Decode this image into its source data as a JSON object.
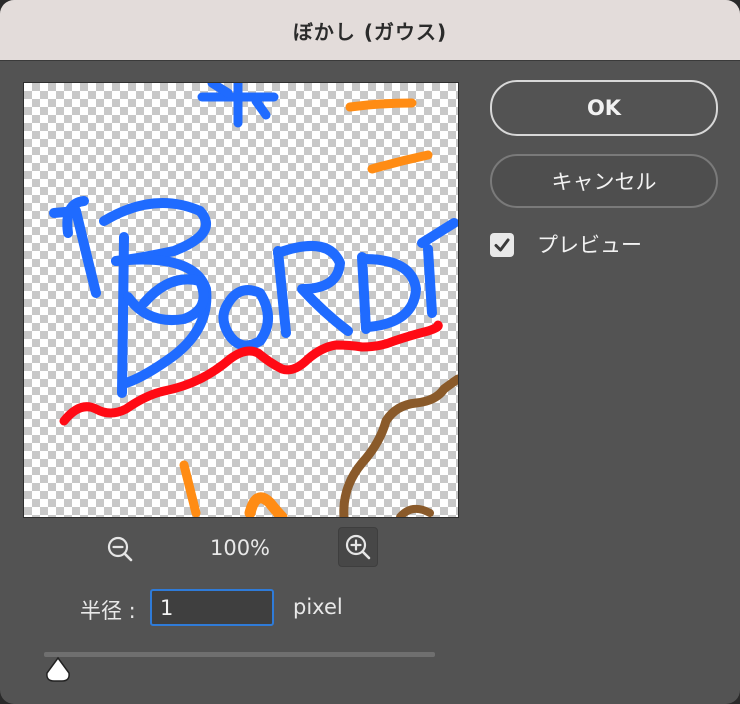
{
  "dialog": {
    "title": "ぼかし (ガウス)"
  },
  "buttons": {
    "ok": "OK",
    "cancel": "キャンセル"
  },
  "preview_checkbox": {
    "label": "プレビュー",
    "checked": true
  },
  "zoom": {
    "percent": "100%"
  },
  "radius": {
    "label": "半径 :",
    "value": "1",
    "unit": "pixel",
    "slider_fraction": 0.02
  },
  "colors": {
    "title_bar": "#e3dcda",
    "panel": "#535353",
    "focus_border": "#2f7bd8",
    "stroke_blue": "#1f6bff",
    "stroke_red": "#ff0a14",
    "stroke_orange": "#ff8c14",
    "stroke_brown": "#8a5a2a"
  },
  "icons": [
    "zoom-out-icon",
    "zoom-in-icon",
    "checkmark-icon",
    "slider-thumb-icon"
  ]
}
